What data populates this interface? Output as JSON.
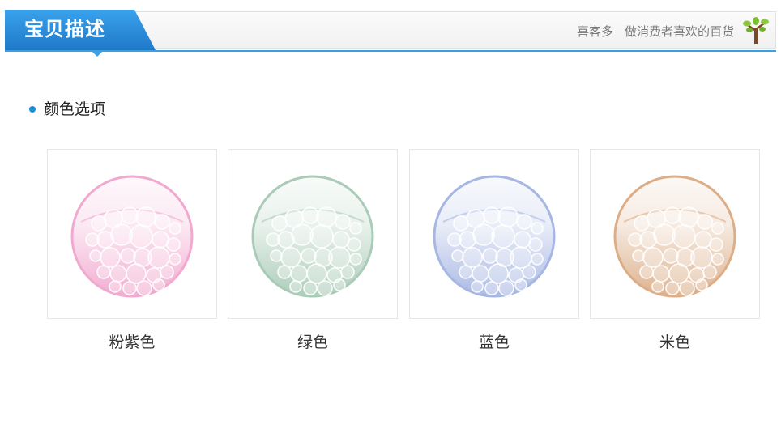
{
  "header": {
    "title": "宝贝描述",
    "brand": "喜客多",
    "tagline": "做消费者喜欢的百货",
    "logo_icon": "tree-icon"
  },
  "section": {
    "title": "颜色选项"
  },
  "options": [
    {
      "label": "粉紫色",
      "color": "#f2a9cf",
      "icon": "soap-holder-icon"
    },
    {
      "label": "绿色",
      "color": "#a9cbb7",
      "icon": "soap-holder-icon"
    },
    {
      "label": "蓝色",
      "color": "#a7b7e3",
      "icon": "soap-holder-icon"
    },
    {
      "label": "米色",
      "color": "#dcae88",
      "icon": "soap-holder-icon"
    }
  ],
  "colors": {
    "accent": "#1f79c9",
    "line": "#3b9fe3"
  }
}
